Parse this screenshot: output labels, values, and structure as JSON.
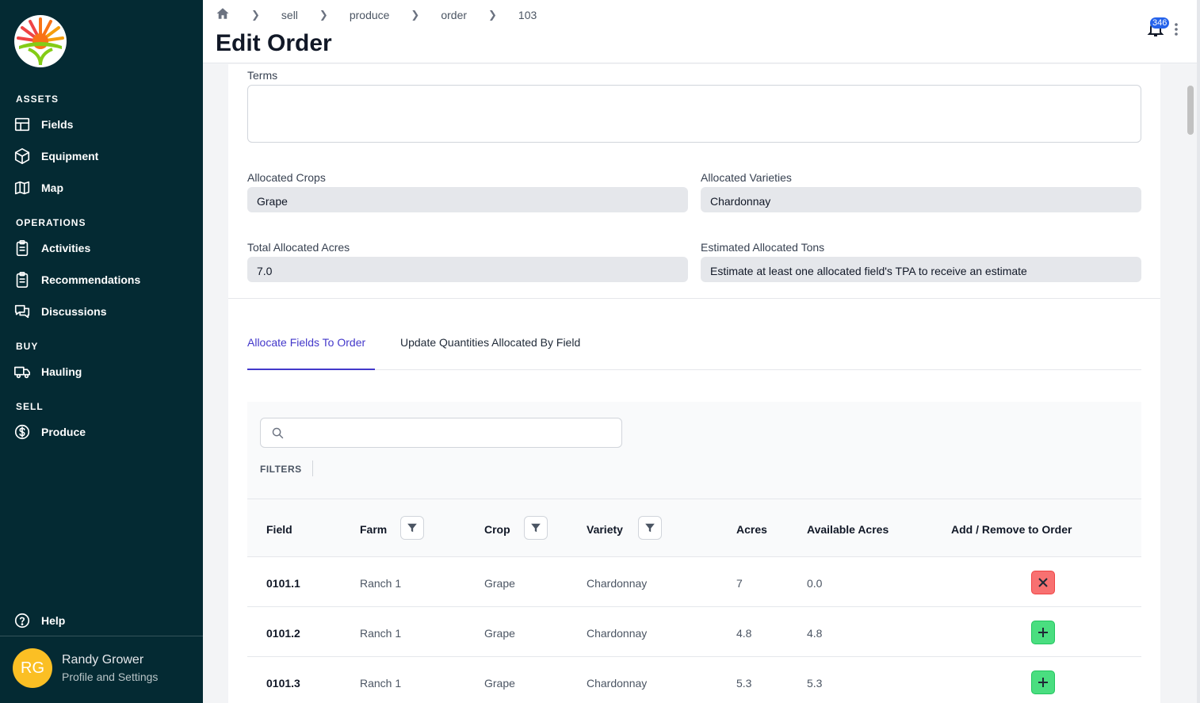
{
  "sidebar": {
    "sections": {
      "assets": "ASSETS",
      "operations": "OPERATIONS",
      "buy": "BUY",
      "sell": "SELL"
    },
    "items": {
      "fields": "Fields",
      "equipment": "Equipment",
      "map": "Map",
      "activities": "Activities",
      "recommendations": "Recommendations",
      "discussions": "Discussions",
      "hauling": "Hauling",
      "produce": "Produce",
      "help": "Help"
    },
    "profile": {
      "initials": "RG",
      "name": "Randy Grower",
      "subtitle": "Profile and Settings"
    }
  },
  "header": {
    "breadcrumb": [
      "sell",
      "produce",
      "order",
      "103"
    ],
    "title": "Edit Order",
    "notification_count": "346"
  },
  "form": {
    "terms_label": "Terms",
    "terms_value": "",
    "allocated_crops_label": "Allocated Crops",
    "allocated_crops_value": "Grape",
    "allocated_varieties_label": "Allocated Varieties",
    "allocated_varieties_value": "Chardonnay",
    "total_acres_label": "Total Allocated Acres",
    "total_acres_value": "7.0",
    "est_tons_label": "Estimated Allocated Tons",
    "est_tons_value": "Estimate at least one allocated field's TPA to receive an estimate"
  },
  "tabs": {
    "allocate": "Allocate Fields To Order",
    "update": "Update Quantities Allocated By Field"
  },
  "table": {
    "search_value": "",
    "filters_label": "FILTERS",
    "columns": {
      "field": "Field",
      "farm": "Farm",
      "crop": "Crop",
      "variety": "Variety",
      "acres": "Acres",
      "available": "Available Acres",
      "action": "Add / Remove to Order"
    },
    "rows": [
      {
        "field": "0101.1",
        "farm": "Ranch 1",
        "crop": "Grape",
        "variety": "Chardonnay",
        "acres": "7",
        "available": "0.0",
        "action": "remove"
      },
      {
        "field": "0101.2",
        "farm": "Ranch 1",
        "crop": "Grape",
        "variety": "Chardonnay",
        "acres": "4.8",
        "available": "4.8",
        "action": "add"
      },
      {
        "field": "0101.3",
        "farm": "Ranch 1",
        "crop": "Grape",
        "variety": "Chardonnay",
        "acres": "5.3",
        "available": "5.3",
        "action": "add"
      }
    ]
  },
  "colors": {
    "sidebar_bg": "#042a33",
    "accent": "#4338ca",
    "remove": "#f87171",
    "add": "#4ade80",
    "avatar": "#fbbf24"
  }
}
